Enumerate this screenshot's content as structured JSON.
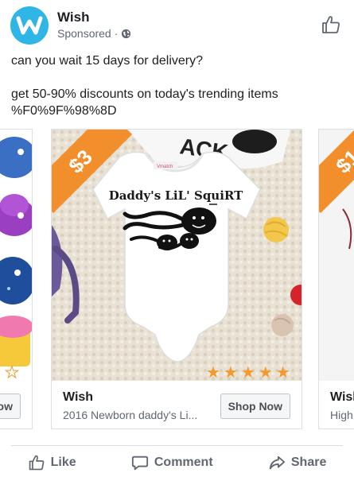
{
  "post": {
    "page_name": "Wish",
    "sponsored_label": "Sponsored",
    "separator": "·",
    "text_line1": "can you wait 15 days for delivery?",
    "text_line2": "get 50-90% discounts on today's trending items",
    "text_line3": "%F0%9F%98%8D"
  },
  "carousel": {
    "left_card": {
      "button_label": "ow"
    },
    "main_card": {
      "price": "$3",
      "garment_print": "Daddy's LiL' SquiRT",
      "title": "Wish",
      "description": "2016 Newborn daddy's Li...",
      "button_label": "Shop Now"
    },
    "right_card": {
      "price": "$1",
      "title": "Wisl",
      "description": "High"
    }
  },
  "actions": {
    "like": "Like",
    "comment": "Comment",
    "share": "Share"
  },
  "colors": {
    "brand": "#2fb5e6",
    "price_tag": "#f28f2c",
    "text_secondary": "#606770"
  },
  "icons": [
    "wish-logo-icon",
    "globe-icon",
    "thumbs-up-icon",
    "comment-icon",
    "share-icon",
    "star-icon"
  ]
}
